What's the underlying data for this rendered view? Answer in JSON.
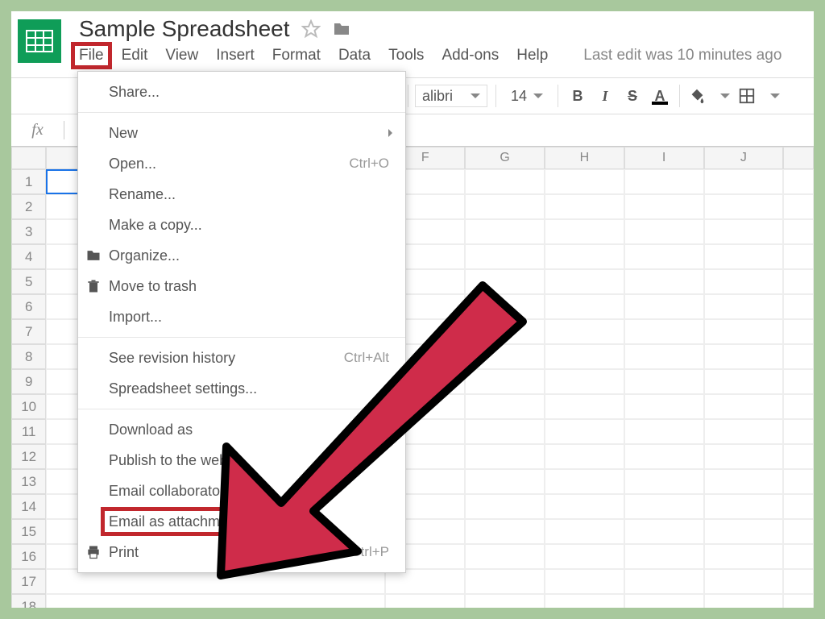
{
  "header": {
    "doc_title": "Sample Spreadsheet",
    "menus": [
      "File",
      "Edit",
      "View",
      "Insert",
      "Format",
      "Data",
      "Tools",
      "Add-ons",
      "Help"
    ],
    "last_edit": "Last edit was 10 minutes ago"
  },
  "toolbar": {
    "font": "alibri",
    "size": "14",
    "bold": "B",
    "italic": "I",
    "strike": "S",
    "text_color": "A"
  },
  "fx": {
    "label": "fx"
  },
  "grid": {
    "visible_columns": [
      "F",
      "G",
      "H",
      "I",
      "J"
    ],
    "row_count": 18
  },
  "file_menu": {
    "items": [
      {
        "label": "Share...",
        "icon": "",
        "shortcut": "",
        "div_after": true
      },
      {
        "label": "New",
        "icon": "",
        "shortcut": "",
        "submenu": true
      },
      {
        "label": "Open...",
        "icon": "",
        "shortcut": "Ctrl+O"
      },
      {
        "label": "Rename...",
        "icon": "",
        "shortcut": ""
      },
      {
        "label": "Make a copy...",
        "icon": "",
        "shortcut": ""
      },
      {
        "label": "Organize...",
        "icon": "folder",
        "shortcut": ""
      },
      {
        "label": "Move to trash",
        "icon": "trash",
        "shortcut": ""
      },
      {
        "label": "Import...",
        "icon": "",
        "shortcut": "",
        "div_after": true
      },
      {
        "label": "See revision history",
        "icon": "",
        "shortcut": "Ctrl+Alt"
      },
      {
        "label": "Spreadsheet settings...",
        "icon": "",
        "shortcut": "",
        "div_after": true
      },
      {
        "label": "Download as",
        "icon": "",
        "shortcut": ""
      },
      {
        "label": "Publish to the web...",
        "icon": "",
        "shortcut": ""
      },
      {
        "label": "Email collaborators...",
        "icon": "",
        "shortcut": ""
      },
      {
        "label": "Email as attachment...",
        "icon": "",
        "shortcut": "",
        "highlight": true
      },
      {
        "label": "Print",
        "icon": "print",
        "shortcut": "Ctrl+P"
      }
    ]
  },
  "annotation": {
    "arrow_color": "#cf2c4a",
    "highlight_color": "#c1272d"
  }
}
